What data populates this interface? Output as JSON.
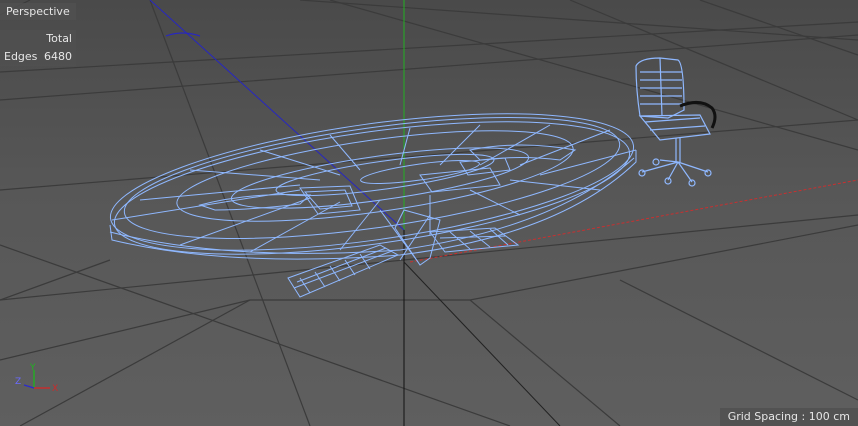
{
  "viewport": {
    "view_name": "Perspective",
    "stats": {
      "header": "Total",
      "edges_label": "Edges",
      "edges_value": "6480"
    },
    "grid_spacing": "Grid Spacing : 100 cm",
    "axis_labels": {
      "x": "X",
      "y": "Y",
      "z": "Z"
    }
  },
  "colors": {
    "wireframe": "#8fb8ff",
    "grid": "#3d3d3d",
    "axis_x": "#cc2b2b",
    "axis_y": "#22b322",
    "axis_z": "#2b2bcc",
    "chair_arm": "#111111"
  }
}
